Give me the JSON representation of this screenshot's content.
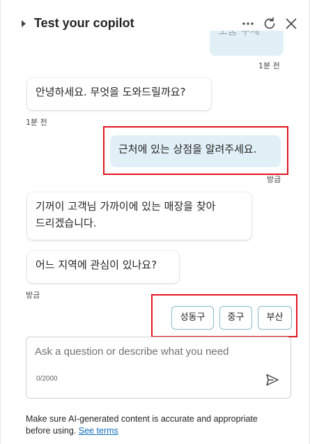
{
  "header": {
    "title": "Test your copilot",
    "more_icon": "more-horizontal-icon",
    "refresh_icon": "refresh-icon",
    "close_icon": "close-icon"
  },
  "messages": {
    "partial_user": {
      "text": "도움 주세"
    },
    "ts_1": "1분 전",
    "bot_1": {
      "text": "안녕하세요. 무엇을 도와드릴까요?"
    },
    "ts_2": "1분 전",
    "user_1": {
      "text": "근처에 있는 상점을 알려주세요."
    },
    "ts_3": "방금",
    "bot_2": {
      "line1": "기꺼이 고객님 가까이에 있는 매장을 찾아",
      "line2": "드리겠습니다."
    },
    "bot_3": {
      "text": "어느 지역에 관심이 있나요?"
    },
    "ts_4": "방금"
  },
  "suggestions": [
    "성동구",
    "중구",
    "부산"
  ],
  "composer": {
    "placeholder": "Ask a question or describe what you need",
    "value": "",
    "counter": "0/2000",
    "send_icon": "send-icon"
  },
  "footer": {
    "disclaimer_line1": "Make sure AI-generated content is accurate and appropriate",
    "disclaimer_line2": "before using.",
    "link": "See terms"
  },
  "colors": {
    "highlight": "#e0141e",
    "user_bubble": "#e1f0f7",
    "chip_border": "#8ab8cc",
    "link": "#0f6cbd"
  }
}
